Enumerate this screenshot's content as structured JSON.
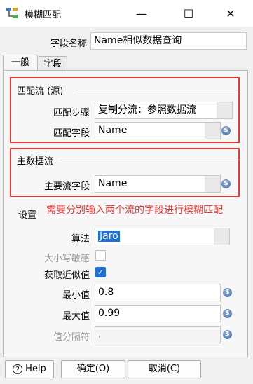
{
  "window": {
    "title": "模糊匹配",
    "minimize": "—",
    "maximize": "☐",
    "close": "✕"
  },
  "step_name": {
    "label": "字段名称",
    "value": "Name相似数据查询"
  },
  "tabs": [
    {
      "label": "一般"
    },
    {
      "label": "字段"
    }
  ],
  "lookup_stream": {
    "title": "匹配流 (源)",
    "step_label": "匹配步骤",
    "step_value": "复制分流：参照数据流",
    "field_label": "匹配字段",
    "field_value": "Name"
  },
  "main_stream": {
    "title": "主数据流",
    "field_label": "主要流字段",
    "field_value": "Name"
  },
  "settings": {
    "title": "设置",
    "annotation": "需要分别输入两个流的字段进行模糊匹配",
    "algorithm_label": "算法",
    "algorithm_value": "Jaro",
    "case_sensitive_label": "大小写敏感",
    "case_sensitive": false,
    "get_closer_label": "获取近似值",
    "get_closer": true,
    "min_label": "最小值",
    "min_value": "0.8",
    "max_label": "最大值",
    "max_value": "0.99",
    "separator_label": "值分隔符",
    "separator_value": ","
  },
  "buttons": {
    "help": "Help",
    "ok": "确定(O)",
    "cancel": "取消(C)"
  },
  "colors": {
    "highlight": "#e53935",
    "selection": "#1e6fd6"
  }
}
